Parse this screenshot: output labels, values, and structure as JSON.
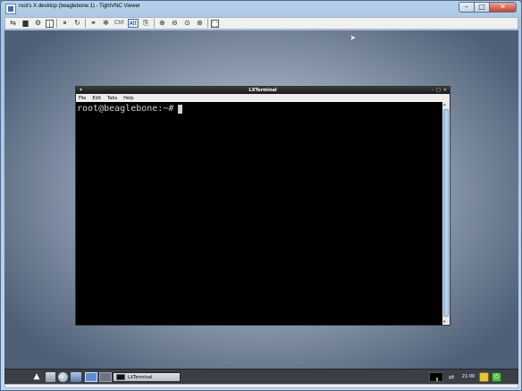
{
  "window": {
    "title": "root's X desktop (beaglebone:1) - TightVNC Viewer",
    "icon": "tightvnc-icon",
    "controls": {
      "minimize": "–",
      "maximize": "□",
      "close": "✕"
    }
  },
  "toolbar": {
    "items": [
      {
        "name": "new-connection-icon",
        "glyph": "⇆"
      },
      {
        "name": "save-icon",
        "glyph": "▆"
      },
      {
        "name": "options-icon",
        "glyph": "⚙"
      },
      {
        "name": "connection-info-icon",
        "glyph": "i"
      },
      {
        "name": "pause-icon",
        "glyph": "⏸"
      },
      {
        "name": "refresh-icon",
        "glyph": "↻"
      },
      {
        "name": "ctrl-alt-del-icon",
        "glyph": "⚭"
      },
      {
        "name": "win-key-icon",
        "glyph": "✻"
      },
      {
        "name": "ctrl-toggle-label",
        "text": "Ctrl"
      },
      {
        "name": "alt-toggle-label",
        "text": "Alt"
      },
      {
        "name": "clipboard-icon",
        "glyph": "⎘"
      },
      {
        "name": "zoom-in-icon",
        "glyph": "⊕"
      },
      {
        "name": "zoom-out-icon",
        "glyph": "⊖"
      },
      {
        "name": "zoom-100-icon",
        "glyph": "⊙"
      },
      {
        "name": "zoom-fit-icon",
        "glyph": "⊗"
      },
      {
        "name": "fullscreen-icon",
        "glyph": "⛶"
      }
    ]
  },
  "terminal": {
    "title": "LXTerminal",
    "menu": [
      "File",
      "Edit",
      "Tabs",
      "Help"
    ],
    "prompt": "root@beaglebone:~#",
    "controls": {
      "minimize": "–",
      "maximize": "□",
      "close": "✕"
    }
  },
  "panel": {
    "task_label": "LXTerminal",
    "clock": "21:00",
    "logout_glyph": "⏻"
  },
  "colors": {
    "terminal_bg": "#000000",
    "terminal_fg": "#d0d0d0",
    "panel_bg": "#3a3f46",
    "scroll_thumb": "#9ec3e8"
  }
}
